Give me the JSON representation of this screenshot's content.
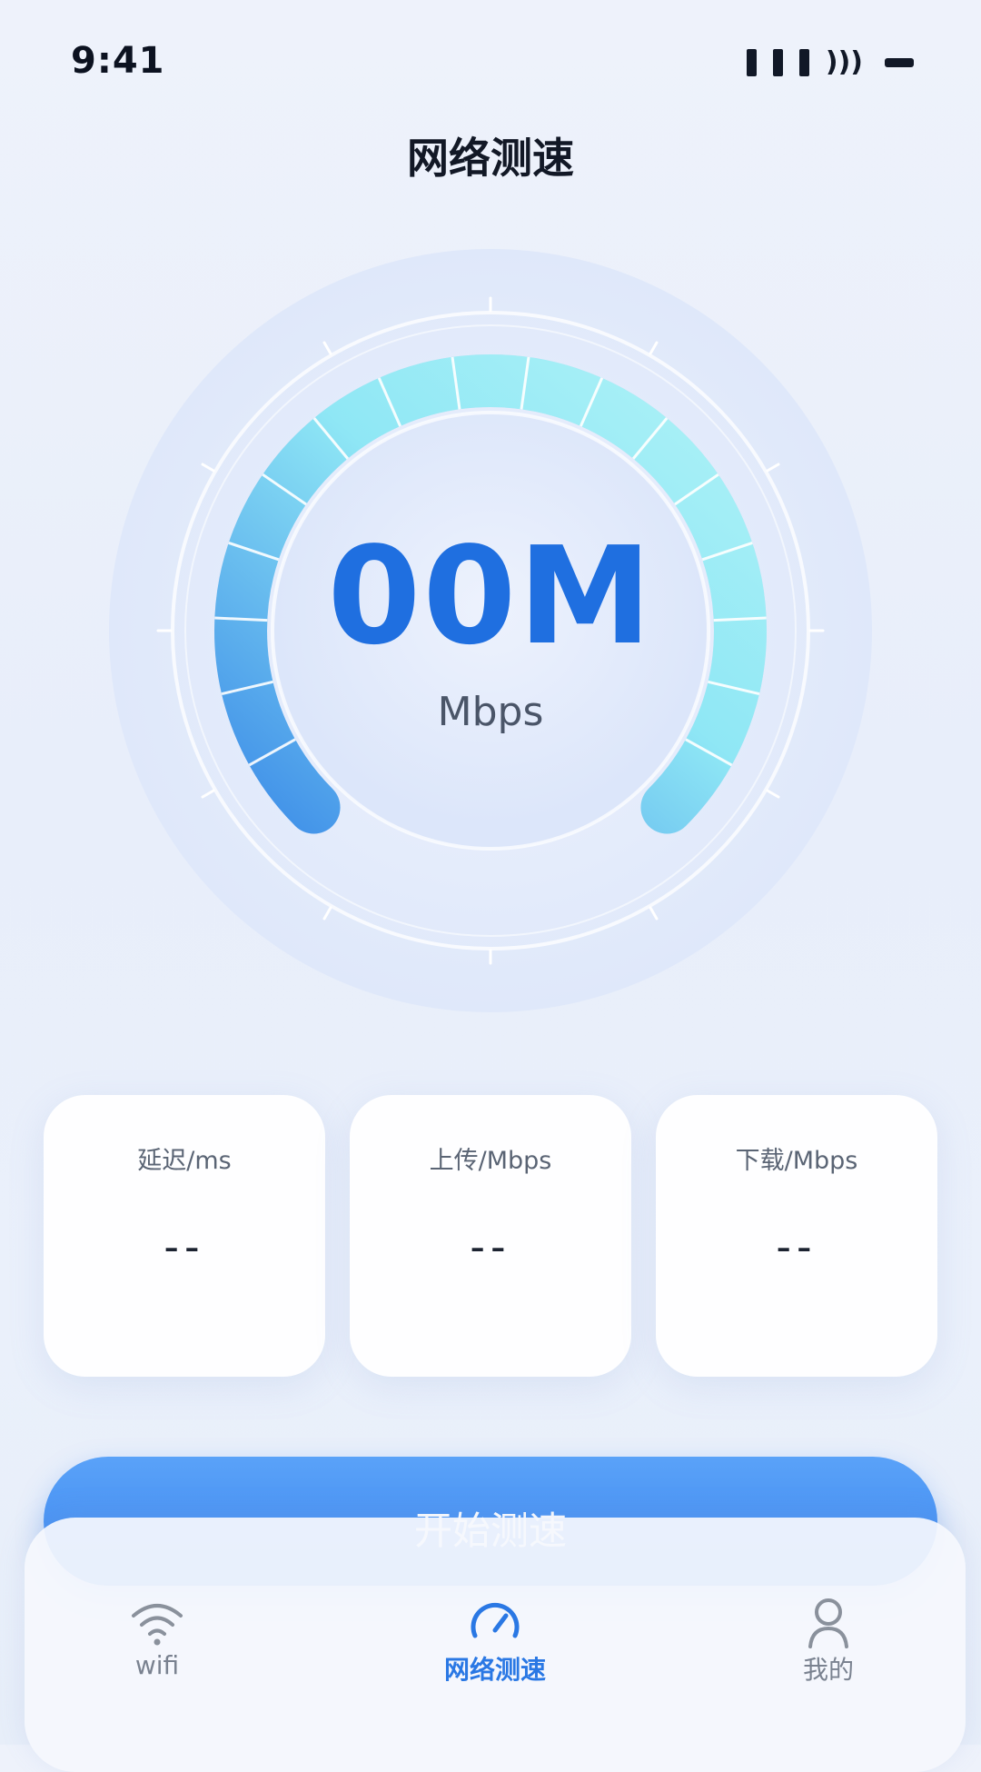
{
  "status_bar": {
    "time": "9:41"
  },
  "header": {
    "title": "网络测速"
  },
  "gauge": {
    "value": "00M",
    "unit": "Mbps",
    "level": 0.0
  },
  "stats": [
    {
      "label": "延迟/ms",
      "value": "--"
    },
    {
      "label": "上传/Mbps",
      "value": "--"
    },
    {
      "label": "下载/Mbps",
      "value": "--"
    }
  ],
  "start_button": {
    "label": "开始测速"
  },
  "nav": {
    "items": [
      {
        "label": "wifi",
        "icon": "wifi-icon",
        "active": false
      },
      {
        "label": "网络测速",
        "icon": "speedometer-icon",
        "active": true
      },
      {
        "label": "我的",
        "icon": "user-icon",
        "active": false
      }
    ]
  },
  "colors": {
    "accent": "#1f6fe0",
    "button": "#3b86f0",
    "nav_active": "#2a78e4",
    "arc_start": "#3f8fe8",
    "arc_end": "#aef2f6"
  }
}
